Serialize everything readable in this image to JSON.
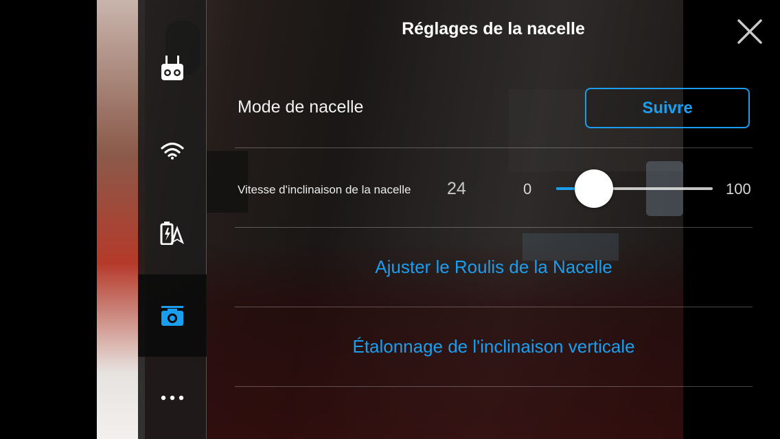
{
  "header": {
    "title": "Réglages de la nacelle",
    "close_icon": "close-icon"
  },
  "sidebar": {
    "items": [
      {
        "icon": "remote-controller-icon",
        "active": false
      },
      {
        "icon": "wifi-icon",
        "active": false
      },
      {
        "icon": "battery-aircraft-icon",
        "active": false
      },
      {
        "icon": "gimbal-camera-icon",
        "active": true
      },
      {
        "icon": "more-icon",
        "active": false
      }
    ]
  },
  "settings": {
    "gimbal_mode": {
      "label": "Mode de nacelle",
      "value": "Suivre"
    },
    "tilt_speed": {
      "label": "Vitesse d'inclinaison de la nacelle",
      "value": "24",
      "min": "0",
      "max": "100",
      "level": 24
    },
    "adjust_roll": {
      "label": "Ajuster le Roulis de la Nacelle"
    },
    "vertical_calibration": {
      "label": "Étalonnage de l'inclinaison verticale"
    }
  },
  "colors": {
    "accent": "#1a9ff0",
    "text": "#f2f2f2",
    "divider": "rgba(255,255,255,0.28)"
  }
}
